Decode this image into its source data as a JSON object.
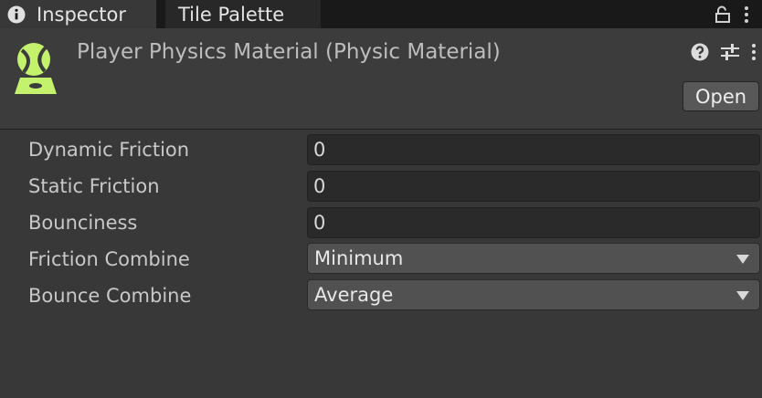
{
  "tabs": [
    {
      "label": "Inspector",
      "icon": "info-icon",
      "active": true
    },
    {
      "label": "Tile Palette",
      "active": false
    }
  ],
  "window_icons": [
    "lock-icon",
    "kebab-menu-icon"
  ],
  "header": {
    "title": "Player Physics Material (Physic Material)",
    "asset_icon": "physic-material-icon",
    "icons": [
      "help-icon",
      "preset-sliders-icon",
      "kebab-menu-icon"
    ],
    "open_label": "Open"
  },
  "properties": [
    {
      "label": "Dynamic Friction",
      "value": "0",
      "kind": "float"
    },
    {
      "label": "Static Friction",
      "value": "0",
      "kind": "float"
    },
    {
      "label": "Bounciness",
      "value": "0",
      "kind": "float"
    },
    {
      "label": "Friction Combine",
      "value": "Minimum",
      "kind": "enum"
    },
    {
      "label": "Bounce Combine",
      "value": "Average",
      "kind": "enum"
    }
  ],
  "colors": {
    "background": "#383838",
    "tabbar": "#191919",
    "accent_icon": "#c4f26d",
    "field": "#2a2a2a",
    "dropdown": "#515151"
  }
}
